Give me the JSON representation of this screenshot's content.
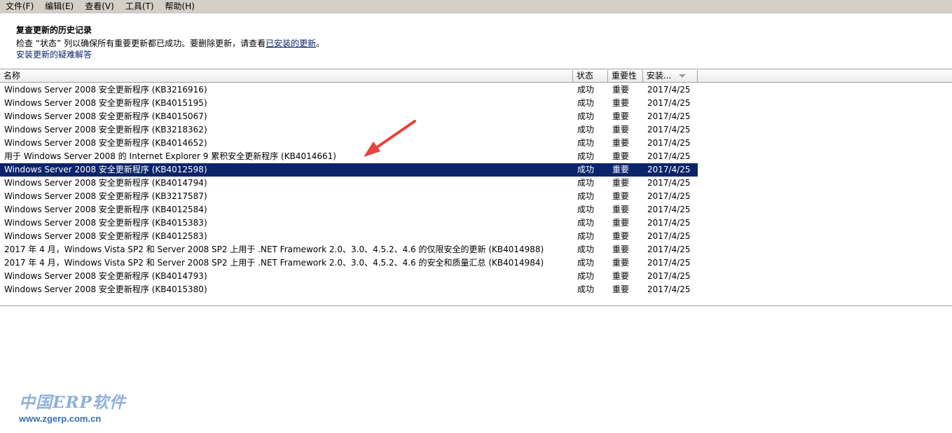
{
  "menu": [
    {
      "id": "file",
      "label": "文件(F)"
    },
    {
      "id": "edit",
      "label": "编辑(E)"
    },
    {
      "id": "view",
      "label": "查看(V)"
    },
    {
      "id": "tools",
      "label": "工具(T)"
    },
    {
      "id": "help",
      "label": "帮助(H)"
    }
  ],
  "header": {
    "title": "复查更新的历史记录",
    "desc_prefix": "检查 “状态” 列以确保所有重要更新都已成功。要删除更新，请查看",
    "desc_link": "已安装的更新",
    "desc_suffix": "。",
    "troubleshoot_link": "安装更新的疑难解答"
  },
  "columns": {
    "name": "名称",
    "status": "状态",
    "importance": "重要性",
    "installed": "安装..."
  },
  "colors": {
    "selected_bg": "#0a246a",
    "link": "#0b246b",
    "arrow": "#e8423b"
  },
  "watermark": {
    "brand": "中国ERP软件",
    "url": "www.zgerp.com.cn"
  },
  "rows": [
    {
      "name": "Windows Server 2008 安全更新程序 (KB3216916)",
      "status": "成功",
      "importance": "重要",
      "date": "2017/4/25"
    },
    {
      "name": "Windows Server 2008 安全更新程序 (KB4015195)",
      "status": "成功",
      "importance": "重要",
      "date": "2017/4/25"
    },
    {
      "name": "Windows Server 2008 安全更新程序 (KB4015067)",
      "status": "成功",
      "importance": "重要",
      "date": "2017/4/25"
    },
    {
      "name": "Windows Server 2008 安全更新程序 (KB3218362)",
      "status": "成功",
      "importance": "重要",
      "date": "2017/4/25"
    },
    {
      "name": "Windows Server 2008 安全更新程序 (KB4014652)",
      "status": "成功",
      "importance": "重要",
      "date": "2017/4/25"
    },
    {
      "name": "用于 Windows Server 2008 的 Internet Explorer 9 累积安全更新程序 (KB4014661)",
      "status": "成功",
      "importance": "重要",
      "date": "2017/4/25"
    },
    {
      "name": "Windows Server 2008 安全更新程序 (KB4012598)",
      "status": "成功",
      "importance": "重要",
      "date": "2017/4/25",
      "selected": true
    },
    {
      "name": "Windows Server 2008 安全更新程序 (KB4014794)",
      "status": "成功",
      "importance": "重要",
      "date": "2017/4/25"
    },
    {
      "name": "Windows Server 2008 安全更新程序 (KB3217587)",
      "status": "成功",
      "importance": "重要",
      "date": "2017/4/25"
    },
    {
      "name": "Windows Server 2008 安全更新程序 (KB4012584)",
      "status": "成功",
      "importance": "重要",
      "date": "2017/4/25"
    },
    {
      "name": "Windows Server 2008 安全更新程序 (KB4015383)",
      "status": "成功",
      "importance": "重要",
      "date": "2017/4/25"
    },
    {
      "name": "Windows Server 2008 安全更新程序 (KB4012583)",
      "status": "成功",
      "importance": "重要",
      "date": "2017/4/25"
    },
    {
      "name": "2017 年 4 月，Windows Vista SP2 和 Server 2008 SP2 上用于 .NET Framework 2.0、3.0、4.5.2、4.6 的仅限安全的更新 (KB4014988)",
      "status": "成功",
      "importance": "重要",
      "date": "2017/4/25"
    },
    {
      "name": "2017 年 4 月，Windows Vista SP2 和 Server 2008 SP2 上用于 .NET Framework 2.0、3.0、4.5.2、4.6 的安全和质量汇总 (KB4014984)",
      "status": "成功",
      "importance": "重要",
      "date": "2017/4/25"
    },
    {
      "name": "Windows Server 2008 安全更新程序 (KB4014793)",
      "status": "成功",
      "importance": "重要",
      "date": "2017/4/25"
    },
    {
      "name": "Windows Server 2008 安全更新程序 (KB4015380)",
      "status": "成功",
      "importance": "重要",
      "date": "2017/4/25"
    }
  ]
}
